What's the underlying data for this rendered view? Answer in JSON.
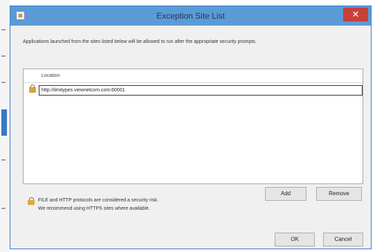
{
  "window": {
    "title": "Exception Site List",
    "close_label": "✕",
    "description": "Applications launched from the sites listed below will be allowed to run after the appropriate security prompts."
  },
  "site_list": {
    "column_header": "Location",
    "entries": [
      {
        "url": "http://timitypes.viewnetcom.com:60001"
      }
    ]
  },
  "buttons": {
    "add": "Add",
    "remove": "Remove",
    "ok": "OK",
    "cancel": "Cancel"
  },
  "warning": {
    "line1": "FILE and HTTP protocols are considered a security risk.",
    "line2": "We recommend using HTTPS sites where available."
  },
  "icons": {
    "app": "java-app-icon",
    "lock": "lock-icon",
    "warning": "lock-warning-icon"
  },
  "colors": {
    "titlebar": "#5b9bd5",
    "close": "#c7403a",
    "window_bg": "#f0f0f0"
  }
}
